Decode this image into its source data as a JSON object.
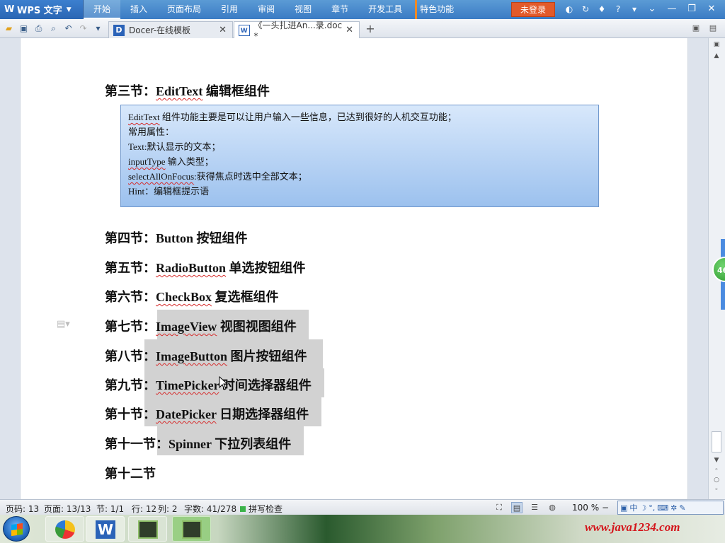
{
  "app": {
    "name": "WPS 文字"
  },
  "menu": {
    "items": [
      "开始",
      "插入",
      "页面布局",
      "引用",
      "审阅",
      "视图",
      "章节",
      "开发工具",
      "特色功能"
    ],
    "login": "未登录"
  },
  "tabs": [
    {
      "label": "Docer-在线模板",
      "icon": "docer-icon"
    },
    {
      "label": "《一头扎进An...录.doc *",
      "icon": "word-doc-icon"
    }
  ],
  "document": {
    "heading3": {
      "prefix": "第三节：",
      "term": "EditText",
      "suffix": " 编辑框组件"
    },
    "infobox": {
      "line1": {
        "term": "EditText",
        "rest": " 组件功能主要是可以让用户输入一些信息，已达到很好的人机交互功能；"
      },
      "line2": "常用属性：",
      "line3": "Text:默认显示的文本；",
      "line4": {
        "term": "inputType",
        "rest": " 输入类型；"
      },
      "line5": {
        "term": "selectAllOnFocus",
        "rest": ":获得焦点时选中全部文本；"
      },
      "line6": "Hint：编辑框提示语"
    },
    "headings": [
      {
        "prefix": "第四节：",
        "term": "Button",
        "suffix": " 按钮组件"
      },
      {
        "prefix": "第五节：",
        "term": "RadioButton",
        "suffix": " 单选按钮组件"
      },
      {
        "prefix": "第六节：",
        "term": "CheckBox",
        "suffix": " 复选框组件"
      },
      {
        "prefix": "第七节：",
        "term": "ImageView",
        "suffix": " 视图视图组件"
      },
      {
        "prefix": "第八节：",
        "term": "ImageButton",
        "suffix": " 图片按钮组件"
      },
      {
        "prefix": "第九节：",
        "term": "TimePicker",
        "suffix": " 时间选择器组件"
      },
      {
        "prefix": "第十节：",
        "term": "DatePicker",
        "suffix": " 日期选择器组件"
      },
      {
        "prefix": "第十一节：",
        "term": "Spinner",
        "suffix": " 下拉列表组件"
      },
      {
        "prefix": "第十二节",
        "term": "",
        "suffix": ""
      }
    ]
  },
  "sidebar": {
    "badge": "46"
  },
  "status": {
    "page_num": "页码: 13",
    "pages": "页面: 13/13",
    "section": "节: 1/1",
    "row": "行: 12",
    "col": "列: 2",
    "wordcount": "字数: 41/278",
    "spell": "拼写检查",
    "zoom": "100 %",
    "zoom_minus": "−"
  },
  "ime": {
    "chinese": "中"
  },
  "taskbar": {
    "watermark": "www.java1234.com"
  },
  "colors": {
    "menubar": "#3a7bc4",
    "selection": "#d2d2d2",
    "infobox": "#9cc1ee",
    "login": "#e25a2a"
  }
}
